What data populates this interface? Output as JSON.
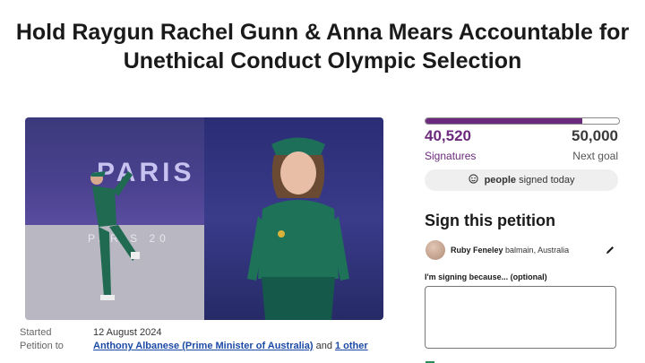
{
  "title": {
    "line1": "Hold Raygun Rachel Gunn & Anna Mears Accountable for",
    "line2": "Unethical Conduct Olympic Selection"
  },
  "photo": {
    "backdrop_text": "PARIS 2",
    "stage_text": "PARIS 20"
  },
  "meta": {
    "started_label": "Started",
    "started_value": "12 August 2024",
    "petition_to_label": "Petition to",
    "recipient": "Anthony Albanese (Prime Minister of Australia)",
    "and_text": "and",
    "others": "1 other"
  },
  "progress": {
    "signatures": "40,520",
    "goal": "50,000",
    "signatures_label": "Signatures",
    "goal_label": "Next goal",
    "fill_fraction": 0.81,
    "accent_color": "#6b2a7c"
  },
  "today": {
    "strong": "people",
    "rest": "signed today",
    "icon": "face-icon"
  },
  "sign": {
    "heading": "Sign this petition",
    "user_name": "Ruby Feneley",
    "user_location": "balmain, Australia",
    "reason_label": "I'm signing because... (optional)",
    "reason_value": ""
  }
}
